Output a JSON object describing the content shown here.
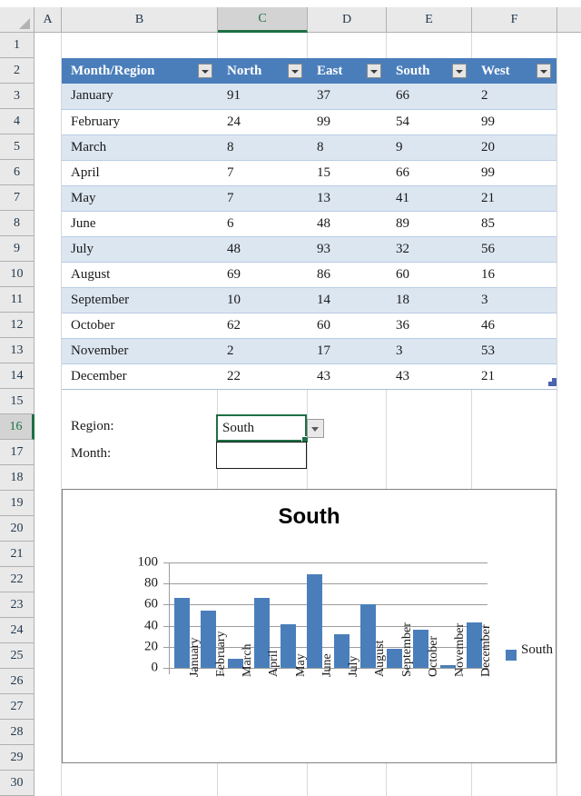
{
  "grid": {
    "column_headers": [
      "A",
      "B",
      "C",
      "D",
      "E",
      "F"
    ],
    "active_column": "C",
    "active_row": "16",
    "row_headers": [
      "1",
      "2",
      "3",
      "4",
      "5",
      "6",
      "7",
      "8",
      "9",
      "10",
      "11",
      "12",
      "13",
      "14",
      "15",
      "16",
      "17",
      "18",
      "19",
      "20",
      "21",
      "22",
      "23",
      "24",
      "25",
      "26",
      "27",
      "28",
      "29",
      "30"
    ]
  },
  "table": {
    "headers": [
      "Month/Region",
      "North",
      "East",
      "South",
      "West"
    ],
    "rows": [
      {
        "month": "January",
        "north": "91",
        "east": "37",
        "south": "66",
        "west": "2"
      },
      {
        "month": "February",
        "north": "24",
        "east": "99",
        "south": "54",
        "west": "99"
      },
      {
        "month": "March",
        "north": "8",
        "east": "8",
        "south": "9",
        "west": "20"
      },
      {
        "month": "April",
        "north": "7",
        "east": "15",
        "south": "66",
        "west": "99"
      },
      {
        "month": "May",
        "north": "7",
        "east": "13",
        "south": "41",
        "west": "21"
      },
      {
        "month": "June",
        "north": "6",
        "east": "48",
        "south": "89",
        "west": "85"
      },
      {
        "month": "July",
        "north": "48",
        "east": "93",
        "south": "32",
        "west": "56"
      },
      {
        "month": "August",
        "north": "69",
        "east": "86",
        "south": "60",
        "west": "16"
      },
      {
        "month": "September",
        "north": "10",
        "east": "14",
        "south": "18",
        "west": "3"
      },
      {
        "month": "October",
        "north": "62",
        "east": "60",
        "south": "36",
        "west": "46"
      },
      {
        "month": "November",
        "north": "2",
        "east": "17",
        "south": "3",
        "west": "53"
      },
      {
        "month": "December",
        "north": "22",
        "east": "43",
        "south": "43",
        "west": "21"
      }
    ]
  },
  "form": {
    "region_label": "Region:",
    "region_value": "South",
    "month_label": "Month:",
    "month_value": ""
  },
  "colors": {
    "header_blue": "#4a7ebb",
    "band_blue": "#dce6f1",
    "selection_green": "#1d7044",
    "bar_blue": "#4a7ebb"
  },
  "chart_data": {
    "type": "bar",
    "title": "South",
    "categories": [
      "January",
      "February",
      "March",
      "April",
      "May",
      "June",
      "July",
      "August",
      "September",
      "October",
      "November",
      "December"
    ],
    "series": [
      {
        "name": "South",
        "values": [
          66,
          54,
          9,
          66,
          41,
          89,
          32,
          60,
          18,
          36,
          3,
          43
        ]
      }
    ],
    "xlabel": "",
    "ylabel": "",
    "ylim": [
      0,
      100
    ],
    "yticks": [
      100,
      80,
      60,
      40,
      20,
      0
    ],
    "grid": true,
    "legend": [
      "South"
    ],
    "legend_position": "right"
  }
}
